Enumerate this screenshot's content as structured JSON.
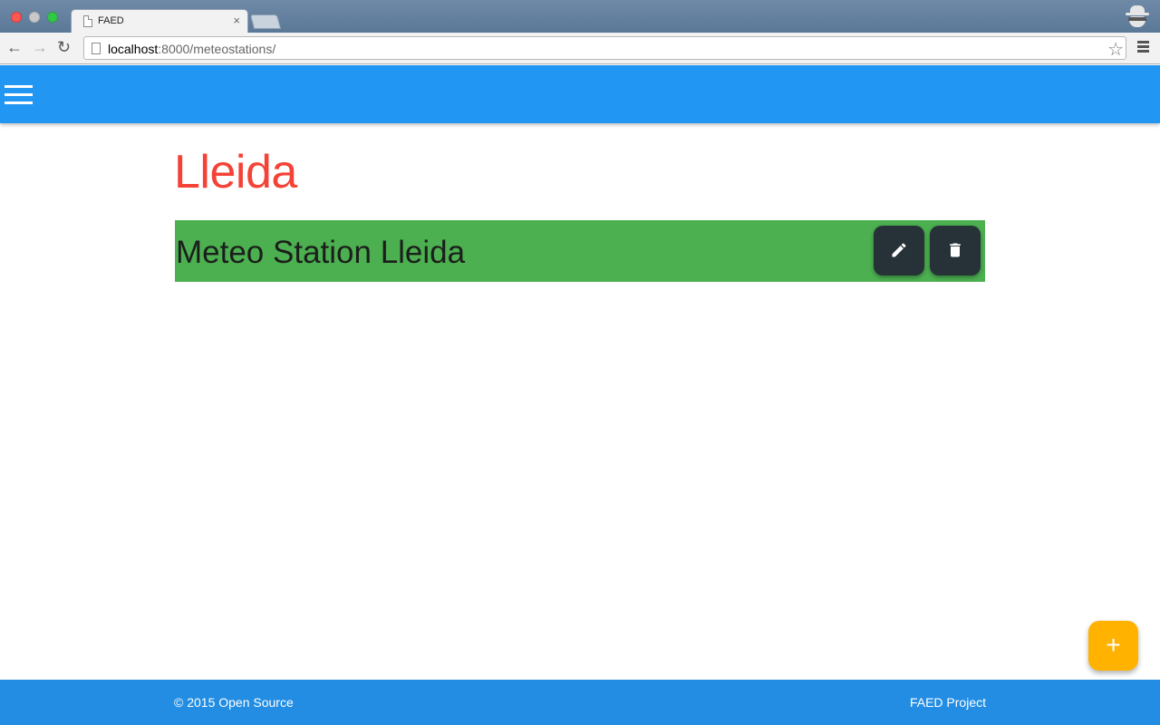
{
  "browser": {
    "tab_title": "FAED",
    "tab_close": "×",
    "url_host": "localhost",
    "url_path": ":8000/meteostations/"
  },
  "icons": {
    "back": "arrow-left-icon",
    "forward": "arrow-right-icon",
    "reload": "reload-icon",
    "star": "star-icon",
    "menu": "hamburger-menu-icon",
    "edit": "pencil-icon",
    "delete": "trash-icon",
    "add": "plus-icon"
  },
  "main": {
    "title": "Lleida",
    "stations": [
      {
        "name": "Meteo Station Lleida"
      }
    ]
  },
  "fab": {
    "label": "+"
  },
  "footer": {
    "left": "© 2015 Open Source",
    "right": "FAED Project"
  },
  "colors": {
    "header": "#2196f3",
    "title": "#f44336",
    "station_bg": "#4caf50",
    "action_bg": "#263238",
    "fab": "#ffb300",
    "footer": "#228de3"
  }
}
